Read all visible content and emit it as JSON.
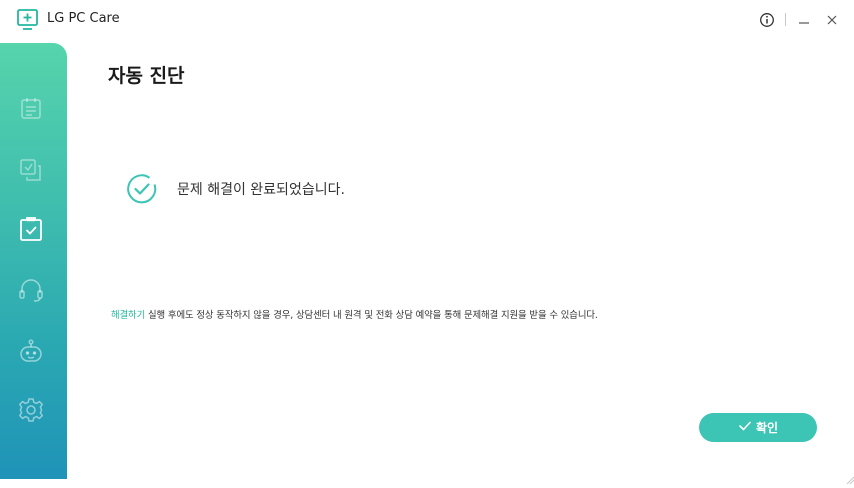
{
  "app": {
    "title": "LG PC Care"
  },
  "window_controls": {
    "info_icon": "info-icon",
    "minimize_icon": "minimize-icon",
    "close_icon": "close-icon"
  },
  "sidebar": {
    "items": [
      {
        "icon": "clipboard-list-icon",
        "active": false
      },
      {
        "icon": "checkbox-copy-icon",
        "active": false
      },
      {
        "icon": "clipboard-check-icon",
        "active": true
      },
      {
        "icon": "headset-icon",
        "active": false
      },
      {
        "icon": "robot-icon",
        "active": false
      },
      {
        "icon": "gear-icon",
        "active": false
      }
    ]
  },
  "main": {
    "title": "자동 진단",
    "result_message": "문제 해결이 완료되었습니다.",
    "help_link": "해결하기",
    "help_text": " 실행 후에도 정상 동작하지 않을 경우, 상담센터 내 원격 및 전화 상담 예약을 통해 문제해결 지원을 받을 수 있습니다.",
    "confirm_label": "확인"
  },
  "colors": {
    "accent": "#3cc4b4",
    "link": "#23b89f",
    "sidebar_top": "#56d4ac",
    "sidebar_bottom": "#1f93b8"
  }
}
